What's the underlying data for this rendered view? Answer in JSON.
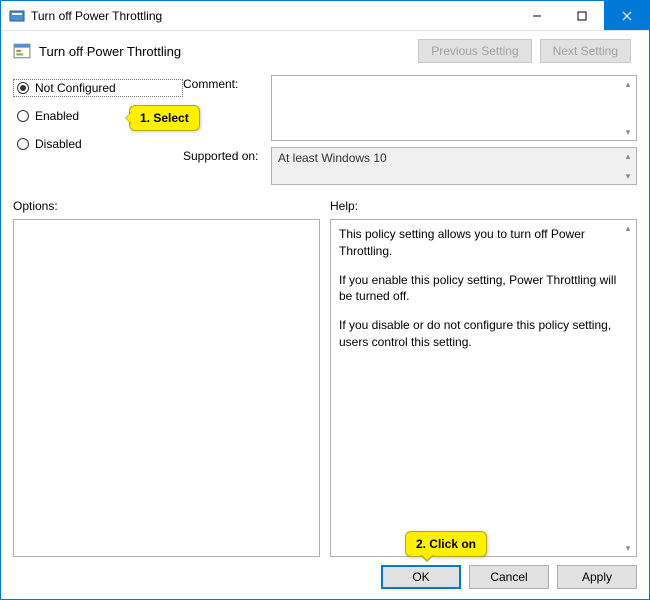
{
  "window": {
    "title": "Turn off Power Throttling"
  },
  "header": {
    "policy_title": "Turn off Power Throttling",
    "previous_setting": "Previous Setting",
    "next_setting": "Next Setting"
  },
  "radio": {
    "not_configured": "Not Configured",
    "enabled": "Enabled",
    "disabled": "Disabled",
    "selected": "not_configured"
  },
  "fields": {
    "comment_label": "Comment:",
    "comment_value": "",
    "supported_label": "Supported on:",
    "supported_value": "At least Windows 10"
  },
  "columns": {
    "options_label": "Options:",
    "help_label": "Help:"
  },
  "help": {
    "p1": "This policy setting allows you to turn off Power Throttling.",
    "p2": "If you enable this policy setting, Power Throttling will be turned off.",
    "p3": "If you disable or do not configure this policy setting, users control this setting."
  },
  "buttons": {
    "ok": "OK",
    "cancel": "Cancel",
    "apply": "Apply"
  },
  "annotations": {
    "select": "1. Select",
    "click_on": "2. Click on"
  }
}
